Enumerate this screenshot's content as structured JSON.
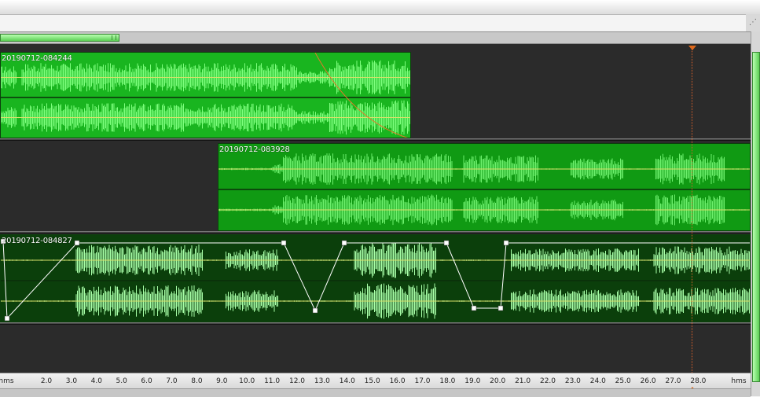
{
  "ruler": {
    "left_unit": "hms",
    "right_unit": "hms",
    "ticks": [
      "2.0",
      "3.0",
      "4.0",
      "5.0",
      "6.0",
      "7.0",
      "8.0",
      "9.0",
      "10.0",
      "11.0",
      "12.0",
      "13.0",
      "14.0",
      "15.0",
      "16.0",
      "17.0",
      "18.0",
      "19.0",
      "20.0",
      "21.0",
      "22.0",
      "23.0",
      "24.0",
      "25.0",
      "26.0",
      "27.0",
      "28.0"
    ]
  },
  "playhead": {
    "time": "28.0"
  },
  "tracks": [
    {
      "clip_name": "20190712-084244",
      "clip_color": "#19b51f",
      "wave_color": "#7dff7d",
      "fade_out": true,
      "envelope": false
    },
    {
      "clip_name": "20190712-083928",
      "clip_color": "#109a13",
      "wave_color": "#6df06d",
      "fade_out": false,
      "envelope": false
    },
    {
      "clip_name": "20190712-084827",
      "clip_color": "#0b3f0b",
      "wave_color": "#a8ffa8",
      "fade_out": false,
      "envelope": true
    }
  ],
  "colors": {
    "timeline_bg": "#2b2b2b",
    "playhead": "#e06a1a",
    "envelope": "#ffffff",
    "center_line": "#d8e06a"
  }
}
